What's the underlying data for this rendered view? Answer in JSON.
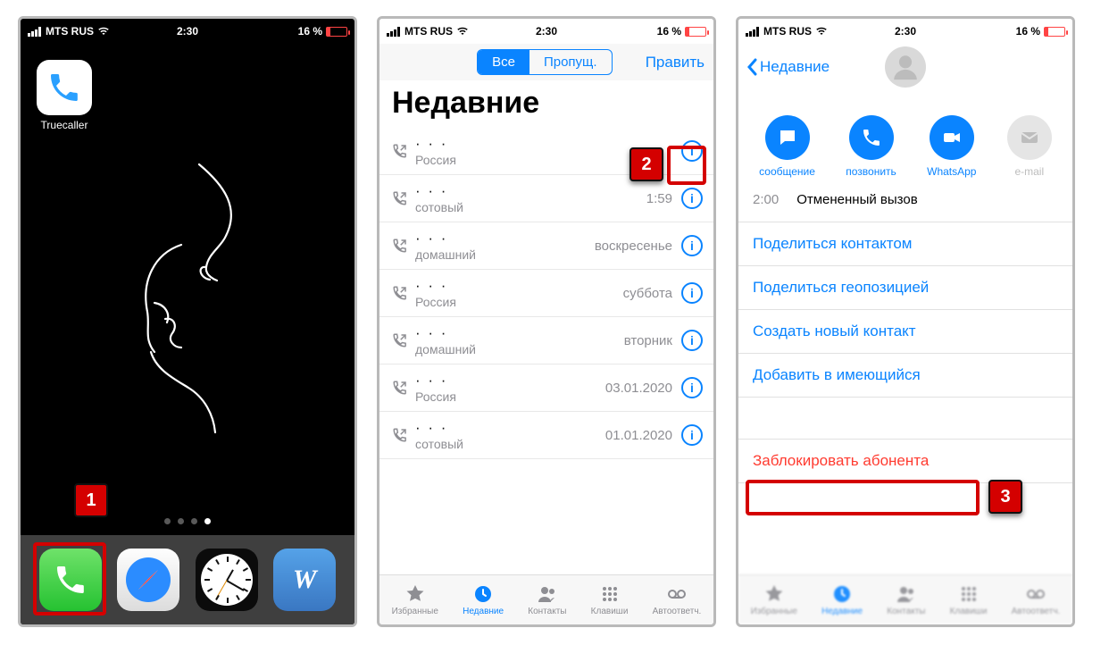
{
  "status": {
    "carrier": "MTS RUS",
    "time": "2:30",
    "battery_pct": "16 %"
  },
  "screen1": {
    "app_label": "Truecaller",
    "annotation": "1"
  },
  "screen2": {
    "segments": {
      "all": "Все",
      "missed": "Пропущ."
    },
    "edit": "Править",
    "title": "Недавние",
    "annotation": "2",
    "rows": [
      {
        "sub": "Россия",
        "time": ""
      },
      {
        "sub": "сотовый",
        "time": "1:59"
      },
      {
        "sub": "домашний",
        "time": "воскресенье"
      },
      {
        "sub": "Россия",
        "time": "суббота"
      },
      {
        "sub": "домашний",
        "time": "вторник"
      },
      {
        "sub": "Россия",
        "time": "03.01.2020"
      },
      {
        "sub": "сотовый",
        "time": "01.01.2020"
      }
    ],
    "tabs": {
      "fav": "Избранные",
      "recent": "Недавние",
      "contacts": "Контакты",
      "keypad": "Клавиши",
      "voicemail": "Автоответч."
    }
  },
  "screen3": {
    "back": "Недавние",
    "actions": {
      "message": "сообщение",
      "call": "позвонить",
      "whatsapp": "WhatsApp",
      "email": "e-mail"
    },
    "log": {
      "time": "2:00",
      "desc": "Отмененный вызов"
    },
    "options": {
      "share_contact": "Поделиться контактом",
      "share_location": "Поделиться геопозицией",
      "new_contact": "Создать новый контакт",
      "add_existing": "Добавить в имеющийся",
      "block": "Заблокировать абонента"
    },
    "annotation": "3",
    "tabs": {
      "fav": "Избранные",
      "recent": "Недавние",
      "contacts": "Контакты",
      "keypad": "Клавиши",
      "voicemail": "Автоответч."
    }
  }
}
